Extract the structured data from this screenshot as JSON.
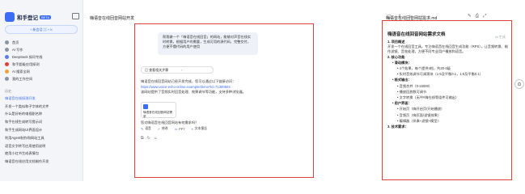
{
  "sidebar": {
    "app_name": "和手登记",
    "badge": "BETA",
    "new_chat": "+ 新会话  ⌘ + K",
    "nav": [
      {
        "label": "首页",
        "color": "#8a94a6"
      },
      {
        "label": "AI 写作",
        "color": "#8a94a6"
      },
      {
        "label": "DeepSeek 探问专线",
        "color": "#5a7cf0"
      },
      {
        "label": "和手超级应用探测",
        "color": "#e0423a"
      },
      {
        "label": "AI 搜索全网",
        "color": "#f0a23a"
      },
      {
        "label": "我的工作空间",
        "color": "#8a94a6"
      }
    ],
    "section_label": "历史",
    "history": [
      "嗨语音在线探测开发",
      "开发一个类似和子字体的文件",
      "什么是好听的电视剧名称",
      "和手在线生成转写提示词",
      "和手生成网站UI界面设计",
      "利用Agent制作和网站工具",
      "语音文字转写应用使用说明",
      "使用小红书生成表情包",
      "嗨语音在线应用文档制作开发"
    ]
  },
  "header": {
    "tab_title": "嗨语音在线回音网站开发",
    "icons": [
      "clipboard-icon",
      "share-icon",
      "star-icon",
      "more-icon"
    ]
  },
  "chat": {
    "user_message": "帮我做一个「嗨语音在线回音」的网站，能够对声音在线实时转换，根据用户的需要，生成可用的源代码，完整交付，方便不懂代码的用户使用",
    "thinking_label": "已 查看相关步骤",
    "answer_intro": "嗨语音在线回音网站已经开发完成，您可以通过以下链接访问：",
    "answer_link": "https://www.voice-echo-online.example/demo?id=71390504",
    "answer_note": "该网站提供了音频实时回音处理、效果调节等功能，支持多种浏览器。",
    "file_name": "嗨语音在线回音网站需求",
    "followup": "您对嗨语音在线回音网站有何需求吗？",
    "chips": [
      {
        "icon": "✎",
        "label": "语音"
      },
      {
        "icon": "✓",
        "label": "修改"
      },
      {
        "icon": "▭",
        "label": "PPT"
      },
      {
        "icon": "≡",
        "label": "文本报告"
      }
    ],
    "actions": [
      "⧉",
      "↻",
      "☺"
    ]
  },
  "doc": {
    "file_name": "嗨语音在线回音网站需求.md",
    "tools": [
      "✎",
      "⎙",
      "⤢"
    ],
    "ai_badge": "AI 生成",
    "h1": "嗨语音在线回音网站需求文档",
    "sec1": "1. 项目概述",
    "sec1_body": "开发一个在线回音工具，专注嗨语音在线回音生成功能（RPS），让音频转换、制作滤镜、音效处理，方便不同专业用户播放和语音。",
    "sec2": "2. 核心功能",
    "group1": "• 滑动模块：",
    "g1_items": [
      "• 4个效果，每个提供4档，共20-4级",
      "• 实时音效调节可调滑块（1-5及平衡0.1，1-5及平衡0.1）"
    ],
    "group2": "• 格式输出：",
    "g2_items": [
      "• 音频合并（0-16000）",
      "• 播放回放数可调节",
      "• 文字转换（无/中/嗨在线等组件可输出）"
    ],
    "group3": "• 用户界面：",
    "g3_items": [
      "• 开始页（嗨开启页/开始播放）",
      "• 音频页（嗨页面/滤镜效果）",
      "• 编辑器（伴奏+滤镜+模型）"
    ],
    "sec3": "3. 技术要求："
  },
  "side_float": "⊙"
}
